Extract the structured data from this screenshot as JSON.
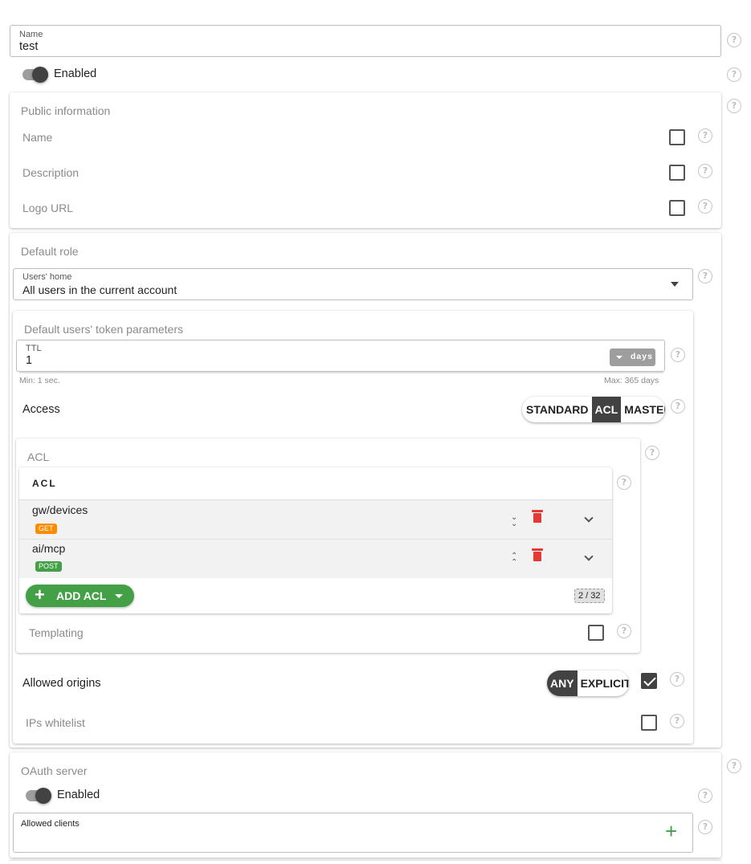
{
  "name_field": {
    "label": "Name",
    "value": "test"
  },
  "enabled_toggle": {
    "label": "Enabled",
    "on": true
  },
  "public_info": {
    "title": "Public information",
    "rows": [
      {
        "label": "Name",
        "checked": false
      },
      {
        "label": "Description",
        "checked": false
      },
      {
        "label": "Logo URL",
        "checked": false
      }
    ]
  },
  "default_role": {
    "title": "Default role",
    "users_home": {
      "label": "Users' home",
      "value": "All users in the current account"
    },
    "token_params": {
      "title": "Default users' token parameters",
      "ttl": {
        "label": "TTL",
        "value": "1",
        "unit": "days",
        "min_hint": "Min: 1 sec.",
        "max_hint": "Max: 365 days"
      },
      "access": {
        "label": "Access",
        "options": [
          "STANDARD",
          "ACL",
          "MASTER"
        ],
        "selected": "ACL"
      },
      "acl": {
        "title": "ACL",
        "table_header": "ACL",
        "items": [
          {
            "path": "gw/devices",
            "method": "GET",
            "method_color": "#fb8c00"
          },
          {
            "path": "ai/mcp",
            "method": "POST",
            "method_color": "#43a047"
          }
        ],
        "add_label": "ADD ACL",
        "count": "2 / 32",
        "templating_label": "Templating"
      },
      "allowed_origins": {
        "label": "Allowed origins",
        "options": [
          "ANY",
          "EXPLICIT"
        ],
        "selected": "ANY",
        "checked": true
      },
      "ips_whitelist": {
        "label": "IPs whitelist",
        "checked": false
      }
    }
  },
  "oauth": {
    "title": "OAuth server",
    "enabled_label": "Enabled",
    "allowed_clients_label": "Allowed clients"
  },
  "colors": {
    "accent_dark": "#424242",
    "add_button": "#43a047",
    "delete": "#e53935",
    "get_badge": "#fb8c00",
    "post_badge": "#43a047"
  }
}
